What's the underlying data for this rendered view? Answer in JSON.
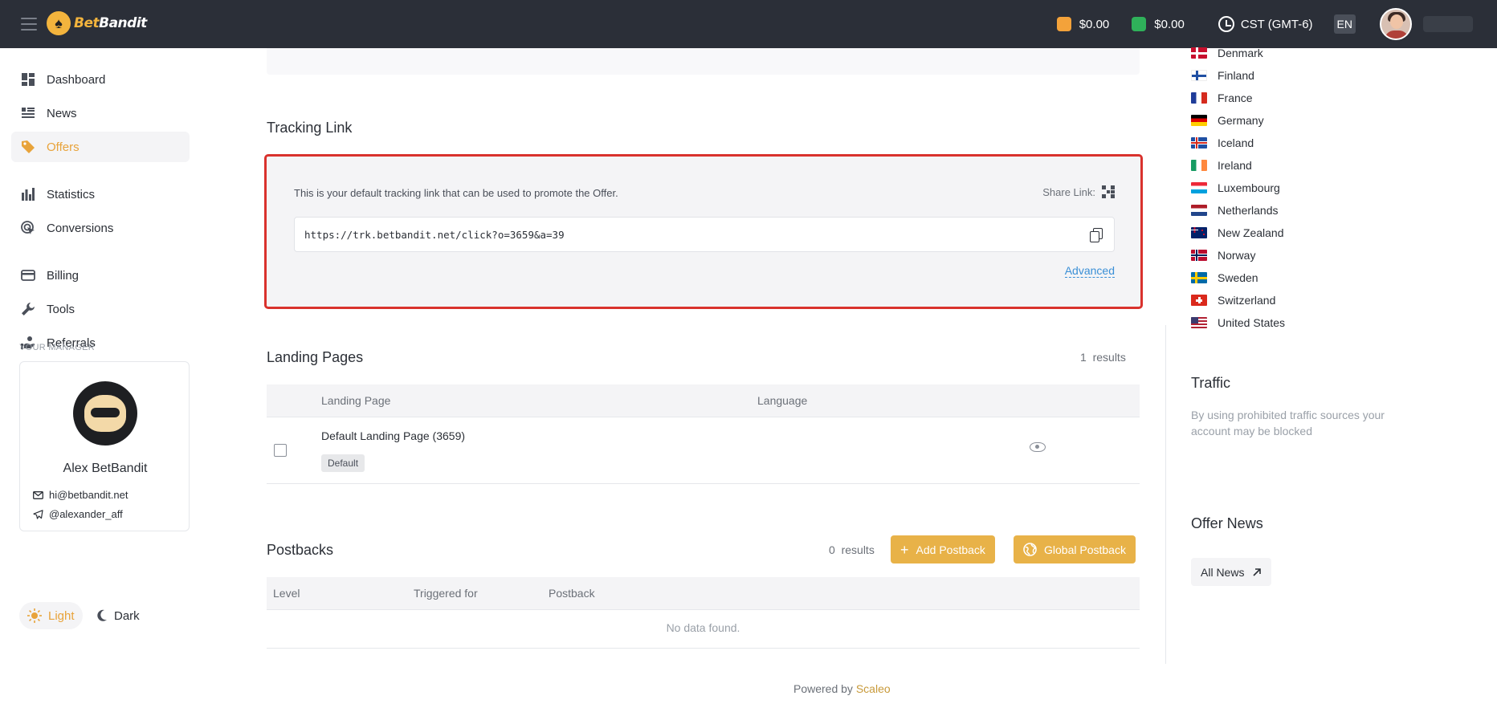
{
  "header": {
    "brand_prefix": "Bet",
    "brand_suffix": "Bandit",
    "wallets": [
      {
        "value": "$0.00",
        "icon": "wallet-orange-icon",
        "color": "#f3a23a"
      },
      {
        "value": "$0.00",
        "icon": "wallet-green-icon",
        "color": "#2fb15a"
      }
    ],
    "timezone": "CST (GMT-6)",
    "language": "EN"
  },
  "sidebar": {
    "items": [
      {
        "label": "Dashboard",
        "icon": "dashboard-icon"
      },
      {
        "label": "News",
        "icon": "news-icon"
      },
      {
        "label": "Offers",
        "icon": "tag-icon",
        "active": true
      },
      {
        "label": "Statistics",
        "icon": "bar-chart-icon"
      },
      {
        "label": "Conversions",
        "icon": "cursor-click-icon"
      },
      {
        "label": "Billing",
        "icon": "credit-card-icon"
      },
      {
        "label": "Tools",
        "icon": "wrench-icon"
      },
      {
        "label": "Referrals",
        "icon": "referral-icon"
      }
    ],
    "manager": {
      "label": "YOUR MANAGER",
      "name": "Alex BetBandit",
      "email": "hi@betbandit.net",
      "telegram": "@alexander_aff"
    },
    "theme": {
      "light": "Light",
      "dark": "Dark"
    }
  },
  "tracking": {
    "title": "Tracking Link",
    "description": "This is your default tracking link that can be used to promote the Offer.",
    "share_label": "Share Link:",
    "url": "https://trk.betbandit.net/click?o=3659&a=39",
    "advanced": "Advanced"
  },
  "landing_pages": {
    "title": "Landing Pages",
    "count": "1",
    "results_label": "results",
    "columns": [
      "Landing Page",
      "Language"
    ],
    "rows": [
      {
        "name": "Default Landing Page (3659)",
        "badge": "Default"
      }
    ]
  },
  "postbacks": {
    "title": "Postbacks",
    "count": "0",
    "results_label": "results",
    "add_button": "Add Postback",
    "global_button": "Global Postback",
    "columns": [
      "Level",
      "Triggered for",
      "Postback"
    ],
    "empty": "No data found."
  },
  "footer": {
    "powered_by": "Powered by",
    "brand": "Scaleo"
  },
  "countries": [
    "Denmark",
    "Finland",
    "France",
    "Germany",
    "Iceland",
    "Ireland",
    "Luxembourg",
    "Netherlands",
    "New Zealand",
    "Norway",
    "Sweden",
    "Switzerland",
    "United States"
  ],
  "traffic": {
    "title": "Traffic",
    "text": "By using prohibited traffic sources your account may be blocked"
  },
  "offer_news": {
    "title": "Offer News",
    "button": "All News"
  }
}
